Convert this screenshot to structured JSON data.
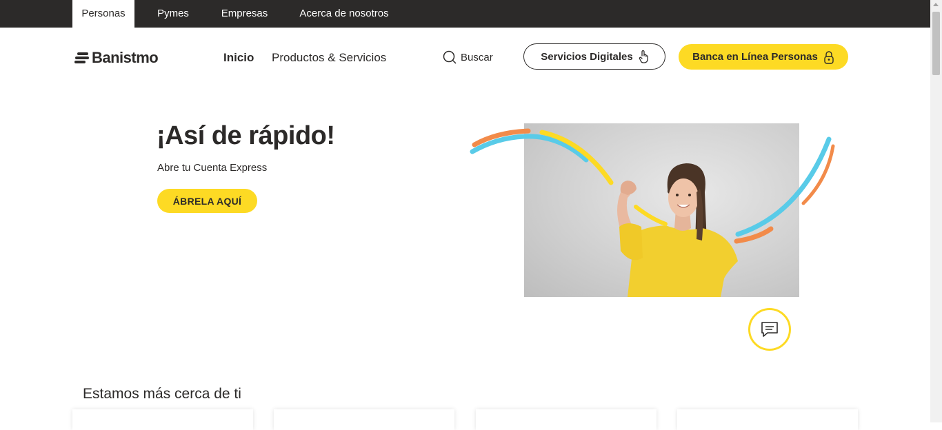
{
  "topnav": {
    "tabs": [
      {
        "label": "Personas",
        "active": true
      },
      {
        "label": "Pymes",
        "active": false
      },
      {
        "label": "Empresas",
        "active": false
      },
      {
        "label": "Acerca de nosotros",
        "active": false
      }
    ]
  },
  "header": {
    "logo_text": "Banistmo",
    "nav": [
      {
        "label": "Inicio"
      },
      {
        "label": "Productos & Servicios"
      }
    ],
    "search_label": "Buscar",
    "digital_button": "Servicios Digitales",
    "online_button": "Banca en Línea Personas"
  },
  "hero": {
    "title": "¡Así de rápido!",
    "subtitle": "Abre tu Cuenta Express",
    "cta": "ÁBRELA AQUÍ"
  },
  "section": {
    "title": "Estamos más cerca de ti"
  },
  "colors": {
    "brand_yellow": "#fdda24",
    "dark": "#2c2a29",
    "arc_blue": "#59cbe8",
    "arc_orange": "#f28b4a"
  },
  "icons": [
    "search-icon",
    "touch-icon",
    "lock-icon",
    "chat-icon"
  ]
}
